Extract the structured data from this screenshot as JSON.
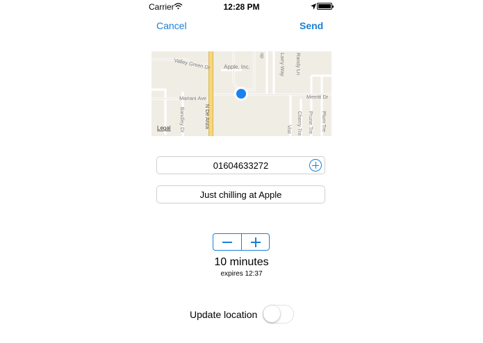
{
  "status_bar": {
    "carrier": "Carrier",
    "time": "12:28 PM",
    "wifi_icon": "wifi-icon",
    "location_icon": "location-arrow-icon",
    "battery_icon": "battery-icon"
  },
  "nav": {
    "cancel_label": "Cancel",
    "send_label": "Send",
    "accent_color": "#1a7fd6"
  },
  "map": {
    "street_labels": {
      "valley_green": "Valley Green Dr",
      "apple_inc": "Apple, Inc.",
      "larry_way": "Larry Way",
      "randy_ln": "Randy Ln",
      "mariani_ave": "Mariani Ave",
      "merritt_dr": "Merritt Dr",
      "n_de_anza": "N De Anza",
      "bandley_dr": "Bandley Dr",
      "vista": "Vist",
      "cherry_tree": "Cherry Tre",
      "prune_tree": "Prune Tre",
      "plum_tree": "Plum Tre",
      "loop": "op"
    },
    "legal_label": "Legal",
    "pin_color": "#1a82f0"
  },
  "phone_field": {
    "value": "01604633272",
    "add_icon": "add-circle-icon"
  },
  "status_field": {
    "value": "Just chilling at Apple"
  },
  "duration": {
    "label": "10 minutes",
    "expires": "expires 12:37",
    "decrement_icon": "minus-icon",
    "increment_icon": "plus-icon"
  },
  "update_location": {
    "label": "Update location",
    "enabled": false
  }
}
